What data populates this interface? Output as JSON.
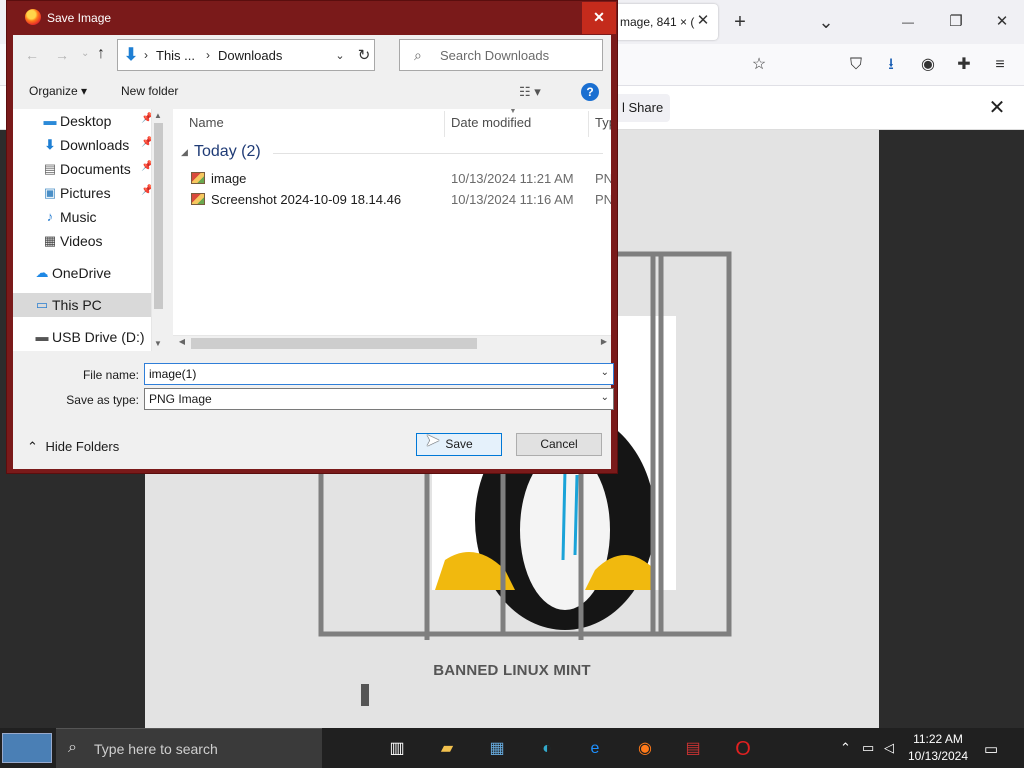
{
  "browser": {
    "tab_title": "mage, 841 × (",
    "tab_close": "✕",
    "new_tab": "+",
    "list_tabs": "⌄",
    "minimize": "—",
    "maximize": "❐",
    "close": "✕",
    "share_button": "l Share",
    "infobar_close": "✕"
  },
  "page": {
    "caption": "BANNED LINUX MINT"
  },
  "dialog": {
    "title": "Save Image",
    "close_glyph": "✕",
    "address": {
      "crumbs": [
        "This ...",
        "Downloads"
      ]
    },
    "search_placeholder": "Search Downloads",
    "toolbar": {
      "organize": "Organize ▾",
      "new_folder": "New folder",
      "help": "?"
    },
    "nav_items": [
      {
        "label": "Desktop",
        "pinned": true
      },
      {
        "label": "Downloads",
        "pinned": true
      },
      {
        "label": "Documents",
        "pinned": true
      },
      {
        "label": "Pictures",
        "pinned": true
      },
      {
        "label": "Music",
        "pinned": false
      },
      {
        "label": "Videos",
        "pinned": false
      },
      {
        "label": "OneDrive",
        "pinned": false
      },
      {
        "label": "This PC",
        "pinned": false
      },
      {
        "label": "USB Drive (D:)",
        "pinned": false
      }
    ],
    "columns": {
      "name": "Name",
      "date_modified": "Date modified",
      "type": "Typ"
    },
    "group_label": "Today (2)",
    "files": [
      {
        "name": "image",
        "date": "10/13/2024 11:21 AM",
        "type": "PN"
      },
      {
        "name": "Screenshot 2024-10-09 18.14.46",
        "date": "10/13/2024 11:16 AM",
        "type": "PN"
      }
    ],
    "file_name_label": "File name:",
    "file_name_value": "image(1)",
    "save_as_type_label": "Save as type:",
    "save_as_type_value": "PNG Image",
    "hide_folders": "Hide Folders",
    "save_button": "Save",
    "cancel_button": "Cancel"
  },
  "taskbar": {
    "search_placeholder": "Type here to search",
    "time": "11:22 AM",
    "date": "10/13/2024"
  }
}
